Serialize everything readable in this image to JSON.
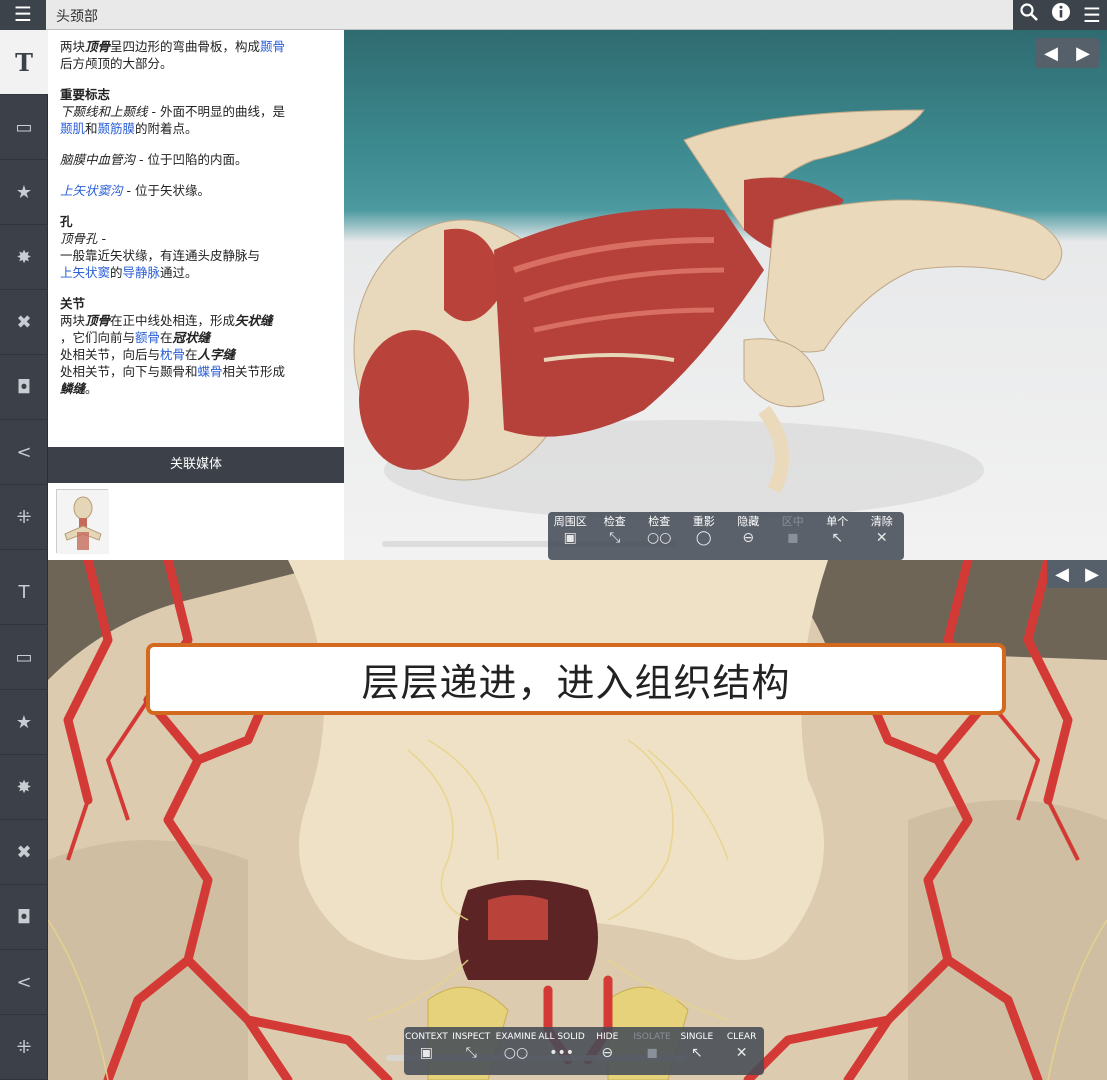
{
  "topbar": {
    "menu_icon": "hamburger-icon",
    "title": "头颈部",
    "right_icons": [
      "search-icon",
      "info-icon",
      "list-icon"
    ]
  },
  "sidebar": {
    "items": [
      {
        "icon": "text-icon",
        "glyph": "T",
        "active": true
      },
      {
        "icon": "frame-icon",
        "glyph": "▭"
      },
      {
        "icon": "star-icon",
        "glyph": "★"
      },
      {
        "icon": "gear-icon",
        "glyph": "✸"
      },
      {
        "icon": "cross-tools-icon",
        "glyph": "✖"
      },
      {
        "icon": "camera-icon",
        "glyph": "◘"
      },
      {
        "icon": "share-icon",
        "glyph": "<"
      },
      {
        "icon": "move-icon",
        "glyph": "⁜"
      }
    ]
  },
  "text_panel": {
    "intro": {
      "t1": "两块",
      "t2": "顶骨",
      "t3": "呈四边形的弯曲骨板，构成",
      "t4": "颞骨",
      "t5": "后方颅顶的大部分。"
    },
    "landmarks": {
      "heading": "重要标志",
      "line1": {
        "t1": "下颞线和上颞线",
        "t2": " - 外面不明显的曲线，是",
        "t3": "颞肌",
        "t4": "和",
        "t5": "颞筋膜",
        "t6": "的附着点。"
      },
      "line2": {
        "t1": "脑膜中血管沟",
        "t2": " - 位于凹陷的内面。"
      },
      "line3": {
        "t1": "上矢状窦沟",
        "t2": " - 位于矢状缘。"
      }
    },
    "foramen": {
      "heading": "孔",
      "t1": "顶骨孔 -",
      "t2": "一般靠近矢状缘，有连通头皮静脉与",
      "t3": "上矢状窦",
      "t4": "的",
      "t5": "导静脉",
      "t6": "通过。"
    },
    "joints": {
      "heading": "关节",
      "t1": "两块",
      "t2": "顶骨",
      "t3": "在正中线处相连，形成",
      "t4": "矢状缝",
      "t5": "，它们向前与",
      "t6": "额骨",
      "t7": "在",
      "t8": "冠状缝",
      "t9": "处相关节，向后与",
      "t10": "枕骨",
      "t11": "在",
      "t12": "人字缝",
      "t13": "处相关节，向下与颞骨和",
      "t14": "蝶骨",
      "t15": "相关节形成",
      "t16": "鳞缝",
      "t17": "。"
    }
  },
  "media": {
    "label": "关联媒体"
  },
  "toolbar_top": [
    {
      "label": "周围区",
      "icon": "context-icon"
    },
    {
      "label": "检查",
      "icon": "inspect-icon"
    },
    {
      "label": "检查",
      "icon": "examine-icon"
    },
    {
      "label": "重影",
      "icon": "ghost-icon"
    },
    {
      "label": "隐藏",
      "icon": "hide-icon"
    },
    {
      "label": "区中",
      "icon": "isolate-icon",
      "dim": true
    },
    {
      "label": "单个",
      "icon": "single-select-icon"
    },
    {
      "label": "清除",
      "icon": "clear-icon"
    }
  ],
  "toolbar_bottom": [
    {
      "label": "CONTEXT",
      "icon": "context-icon"
    },
    {
      "label": "INSPECT",
      "icon": "inspect-icon"
    },
    {
      "label": "EXAMINE",
      "icon": "examine-icon"
    },
    {
      "label": "ALL SOLID",
      "icon": "all-solid-icon"
    },
    {
      "label": "HIDE",
      "icon": "hide-icon"
    },
    {
      "label": "ISOLATE",
      "icon": "isolate-icon",
      "dim": true
    },
    {
      "label": "SINGLE",
      "icon": "single-select-icon"
    },
    {
      "label": "CLEAR",
      "icon": "clear-icon"
    }
  ],
  "caption": {
    "text": "层层递进，进入组织结构"
  },
  "colors": {
    "accent_link": "#2a5fd6",
    "caption_border": "#d2691e",
    "artery": "#d43a35",
    "bone": "#ecdcbf",
    "muscle": "#b8423b",
    "nerve": "#e8d488"
  }
}
